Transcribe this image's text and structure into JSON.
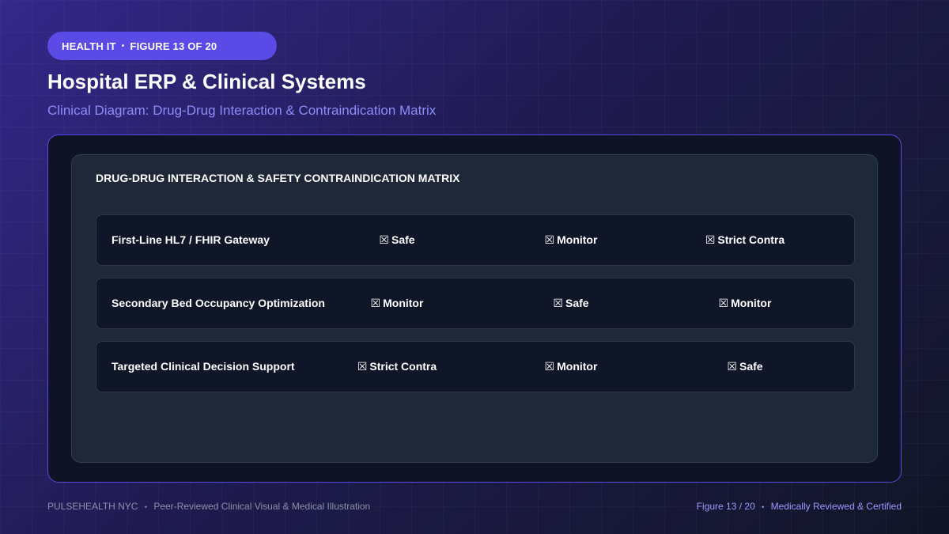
{
  "badge": {
    "category": "HEALTH IT",
    "separator": "•",
    "figure": "FIGURE 13 OF 20"
  },
  "header": {
    "title": "Hospital ERP & Clinical Systems",
    "subtitle": "Clinical Diagram: Drug-Drug Interaction & Contraindication Matrix"
  },
  "matrix": {
    "title": "DRUG-DRUG INTERACTION & SAFETY CONTRAINDICATION MATRIX",
    "mark_glyph": "☒",
    "rows": [
      {
        "label": "First-Line HL7 / FHIR Gateway",
        "cells": [
          "Safe",
          "Monitor",
          "Strict Contra"
        ]
      },
      {
        "label": "Secondary Bed Occupancy Optimization",
        "cells": [
          "Monitor",
          "Safe",
          "Monitor"
        ]
      },
      {
        "label": "Targeted Clinical Decision Support",
        "cells": [
          "Strict Contra",
          "Monitor",
          "Safe"
        ]
      }
    ]
  },
  "footer": {
    "org": "PULSEHEALTH NYC",
    "separator": "•",
    "tagline": "Peer-Reviewed Clinical Visual & Medical Illustration",
    "figure": "Figure 13 / 20",
    "certification": "Medically Reviewed & Certified"
  },
  "colors": {
    "accent": "#5a4ae6",
    "subtitle": "#8f8cf8",
    "panel": "#1e2838",
    "row": "#0e1627"
  }
}
